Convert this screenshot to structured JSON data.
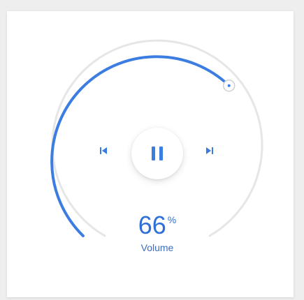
{
  "player": {
    "volume_value": "66",
    "volume_unit": "%",
    "volume_label": "Volume",
    "volume_fraction": 0.66,
    "state": "playing"
  },
  "controls": {
    "previous": {
      "icon": "skip-previous-icon"
    },
    "play_pause": {
      "icon": "pause-icon"
    },
    "next": {
      "icon": "skip-next-icon"
    }
  },
  "colors": {
    "accent": "#3b7de0",
    "track": "#e6e6e6",
    "card": "#ffffff",
    "background": "#eeeeee",
    "text_accent": "#2f6fd8"
  }
}
